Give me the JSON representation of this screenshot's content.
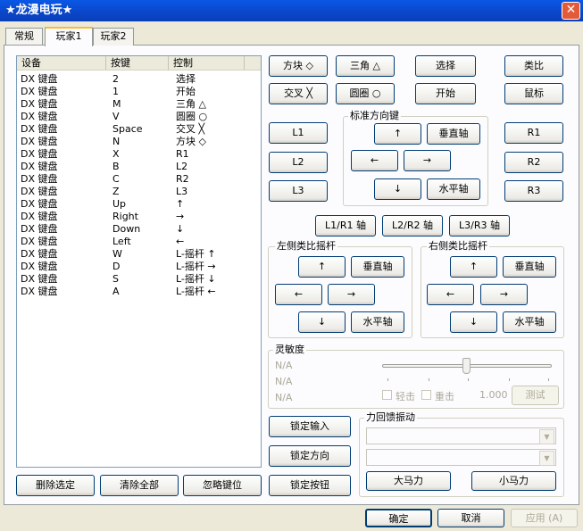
{
  "window": {
    "title": "★龙漫电玩★",
    "close_glyph": "✕"
  },
  "tabs": [
    {
      "label": "常规"
    },
    {
      "label": "玩家1"
    },
    {
      "label": "玩家2"
    }
  ],
  "mapping_list": {
    "columns": [
      "设备",
      "按键",
      "控制"
    ],
    "rows": [
      {
        "device": "DX 键盘",
        "key": "2",
        "control": "选择"
      },
      {
        "device": "DX 键盘",
        "key": "1",
        "control": "开始"
      },
      {
        "device": "DX 键盘",
        "key": "M",
        "control": "三角 △"
      },
      {
        "device": "DX 键盘",
        "key": "V",
        "control": "圆圈 ○"
      },
      {
        "device": "DX 键盘",
        "key": "Space",
        "control": "交叉 ╳"
      },
      {
        "device": "DX 键盘",
        "key": "N",
        "control": "方块 ◇"
      },
      {
        "device": "DX 键盘",
        "key": "X",
        "control": "R1"
      },
      {
        "device": "DX 键盘",
        "key": "B",
        "control": "L2"
      },
      {
        "device": "DX 键盘",
        "key": "C",
        "control": "R2"
      },
      {
        "device": "DX 键盘",
        "key": "Z",
        "control": "L3"
      },
      {
        "device": "DX 键盘",
        "key": "Up",
        "control": "↑"
      },
      {
        "device": "DX 键盘",
        "key": "Right",
        "control": "→"
      },
      {
        "device": "DX 键盘",
        "key": "Down",
        "control": "↓"
      },
      {
        "device": "DX 键盘",
        "key": "Left",
        "control": "←"
      },
      {
        "device": "DX 键盘",
        "key": "W",
        "control": "L-摇杆 ↑"
      },
      {
        "device": "DX 键盘",
        "key": "D",
        "control": "L-摇杆 →"
      },
      {
        "device": "DX 键盘",
        "key": "S",
        "control": "L-摇杆 ↓"
      },
      {
        "device": "DX 键盘",
        "key": "A",
        "control": "L-摇杆 ←"
      }
    ]
  },
  "list_buttons": {
    "delete_selected": "删除选定",
    "clear_all": "清除全部",
    "ignore_key": "忽略键位"
  },
  "face_buttons": {
    "square": "方块 ◇",
    "triangle": "三角 △",
    "select": "选择",
    "analog": "类比",
    "cross": "交叉 ╳",
    "circle": "圆圈 ○",
    "start": "开始",
    "mouse": "鼠标"
  },
  "shoulders": {
    "l1": "L1",
    "l2": "L2",
    "l3": "L3",
    "r1": "R1",
    "r2": "R2",
    "r3": "R3"
  },
  "dpad": {
    "label": "标准方向键",
    "up": "↑",
    "down": "↓",
    "left": "←",
    "right": "→",
    "vertical": "垂直轴",
    "horizontal": "水平轴"
  },
  "axis_buttons": {
    "l1r1": "L1/R1 轴",
    "l2r2": "L2/R2 轴",
    "l3r3": "L3/R3 轴"
  },
  "left_stick": {
    "label": "左侧类比摇杆",
    "up": "↑",
    "down": "↓",
    "left": "←",
    "right": "→",
    "vertical": "垂直轴",
    "horizontal": "水平轴"
  },
  "right_stick": {
    "label": "右侧类比摇杆",
    "up": "↑",
    "down": "↓",
    "left": "←",
    "right": "→",
    "vertical": "垂直轴",
    "horizontal": "水平轴"
  },
  "sensitivity": {
    "label": "灵敏度",
    "na": [
      "N/A",
      "N/A",
      "N/A"
    ],
    "light": "轻击",
    "heavy": "重击",
    "value": "1.000",
    "test": "测试",
    "slider_level": 0.5
  },
  "lock_buttons": {
    "lock_input": "锁定输入",
    "lock_direction": "锁定方向",
    "lock_button": "锁定按钮"
  },
  "force_feedback": {
    "label": "力回馈振动",
    "combo1": "",
    "combo2": "",
    "big_motor": "大马力",
    "small_motor": "小马力"
  },
  "dialog": {
    "ok": "确定",
    "cancel": "取消",
    "apply": "应用 (A)"
  }
}
